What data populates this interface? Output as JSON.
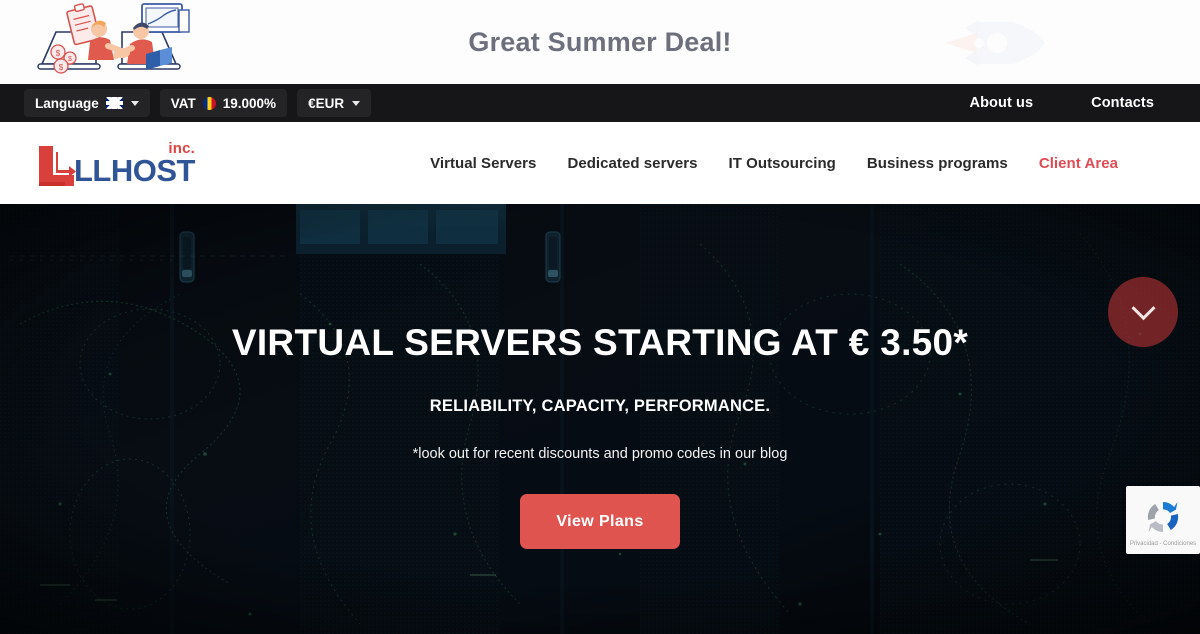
{
  "promo": {
    "text": "Great Summer Deal!",
    "left_illustration": "handshake-deal-illustration",
    "right_illustration": "rocket-illustration"
  },
  "topbar": {
    "language": {
      "label": "Language",
      "flag": "uk-flag-icon",
      "caret": "chevron-down-icon"
    },
    "vat": {
      "label": "VAT",
      "flag": "romania-flag-icon",
      "value": "19.000%"
    },
    "currency": {
      "label": "€EUR",
      "caret": "chevron-down-icon"
    },
    "links": [
      {
        "label": "About us"
      },
      {
        "label": "Contacts"
      }
    ]
  },
  "header": {
    "logo": {
      "word": "LLHOST",
      "suffix": "inc.",
      "mark": "llhost-l-mark-icon"
    },
    "nav": [
      {
        "label": "Virtual Servers",
        "accent": false
      },
      {
        "label": "Dedicated servers",
        "accent": false
      },
      {
        "label": "IT Outsourcing",
        "accent": false
      },
      {
        "label": "Business programs",
        "accent": false
      },
      {
        "label": "Client Area",
        "accent": true
      }
    ]
  },
  "hero": {
    "title": "VIRTUAL SERVERS STARTING AT € 3.50*",
    "subtitle": "RELIABILITY, CAPACITY, PERFORMANCE.",
    "note": "*look out for recent discounts and promo codes in our blog",
    "cta_label": "View Plans",
    "scroll_icon": "chevron-down-icon",
    "background": "datacenter-server-room-dark-photo"
  },
  "recaptcha": {
    "icon": "recaptcha-logo-icon",
    "legal": "Privacidad - Condiciones"
  },
  "colors": {
    "accent_red": "#e14b54",
    "button_red": "#e0544f",
    "logo_blue": "#2f5596",
    "logo_red": "#df4343",
    "topbar_bg": "#161618",
    "promo_text": "#6d707c"
  }
}
